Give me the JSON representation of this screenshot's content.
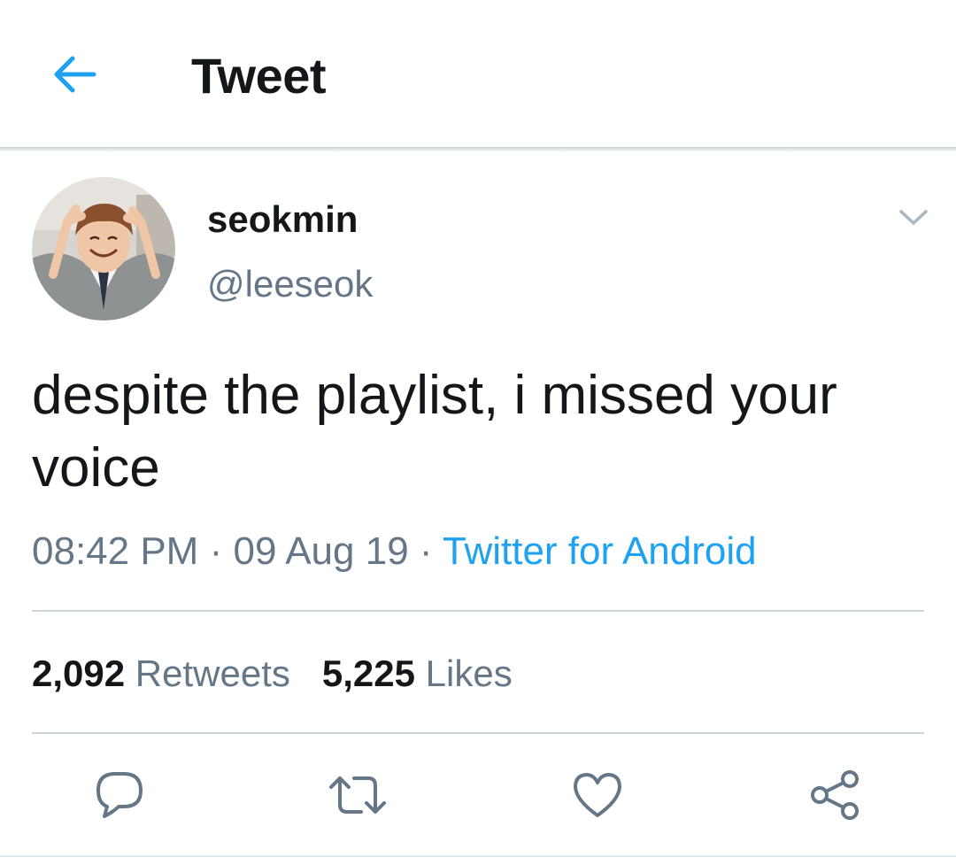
{
  "header": {
    "title": "Tweet",
    "back_icon": "arrow-left-icon",
    "accent_color": "#1da1f2"
  },
  "tweet": {
    "author": {
      "display_name": "seokmin",
      "handle": "@leeseok"
    },
    "text": "despite the playlist, i missed your voice",
    "time": "08:42 PM",
    "separator": "·",
    "date": "09 Aug 19",
    "source": "Twitter for Android",
    "stats": {
      "retweets_count": "2,092",
      "retweets_label": "Retweets",
      "likes_count": "5,225",
      "likes_label": "Likes"
    },
    "actions": [
      "reply-icon",
      "retweet-icon",
      "like-icon",
      "share-icon"
    ]
  },
  "colors": {
    "text_primary": "#14171a",
    "text_secondary": "#657786",
    "link": "#1da1f2",
    "divider": "#ccd6dd"
  }
}
